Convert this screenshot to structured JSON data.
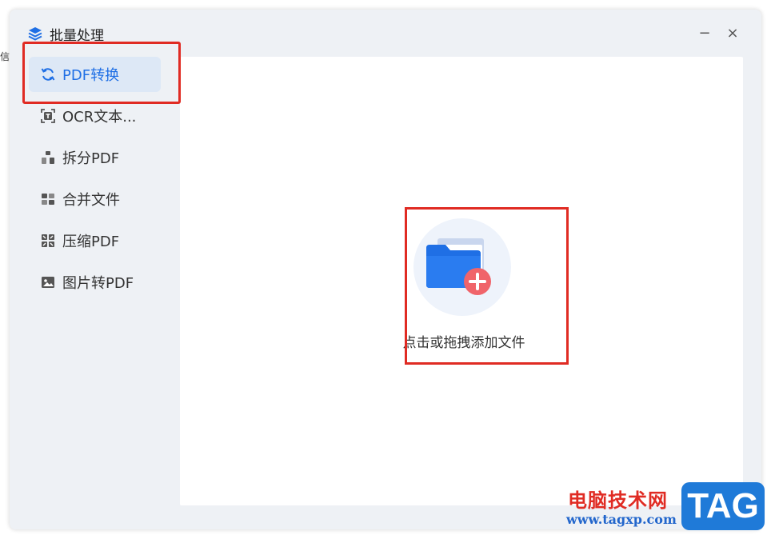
{
  "edge_text": "信",
  "window": {
    "title": "批量处理",
    "minimize_glyph": "−",
    "close_glyph": "×"
  },
  "sidebar": {
    "items": [
      {
        "label": "PDF转换",
        "icon": "refresh-icon",
        "active": true
      },
      {
        "label": "OCR文本...",
        "icon": "ocr-text-icon",
        "active": false
      },
      {
        "label": "拆分PDF",
        "icon": "split-icon",
        "active": false
      },
      {
        "label": "合并文件",
        "icon": "merge-icon",
        "active": false
      },
      {
        "label": "压缩PDF",
        "icon": "compress-icon",
        "active": false
      },
      {
        "label": "图片转PDF",
        "icon": "image-icon",
        "active": false
      }
    ]
  },
  "main": {
    "drop_label": "点击或拖拽添加文件",
    "folder_icon": "folder-add-icon"
  },
  "watermark": {
    "text": "电脑技术网",
    "url": "www.tagxp.com",
    "badge": "TAG"
  },
  "colors": {
    "accent": "#1f6fe5",
    "highlight": "#e02b23",
    "window_bg": "#eef1f5",
    "active_bg": "#dde8f6"
  }
}
